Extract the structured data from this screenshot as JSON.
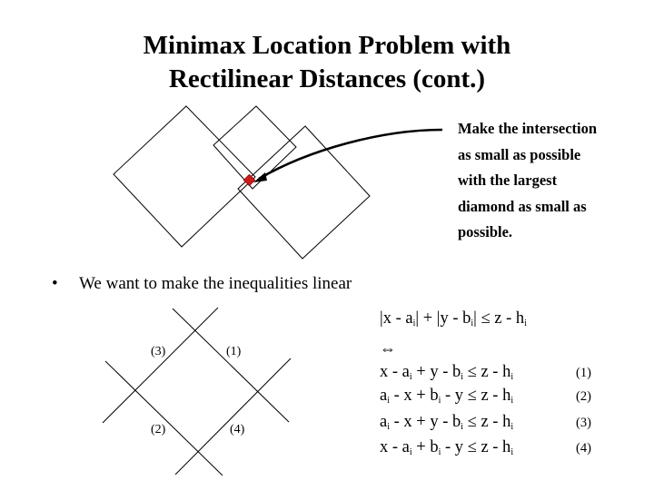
{
  "title": {
    "line1": "Minimax Location Problem with",
    "line2": "Rectilinear Distances (cont.)"
  },
  "callout": {
    "lines": [
      "Make the intersection",
      "as small as possible",
      "with the largest",
      "diamond as small as",
      "possible."
    ]
  },
  "colors": {
    "intersection_marker": "#cc1a1a",
    "lines": "#000000"
  },
  "bullet": {
    "symbol": "•",
    "text": "We want to make the inequalities linear"
  },
  "diagram_labels": {
    "top_left": "(3)",
    "top_right": "(1)",
    "bottom_left": "(2)",
    "bottom_right": "(4)"
  },
  "equations": {
    "absolute": {
      "p1": "|x - a",
      "s1": "i",
      "p2": "| + |y - b",
      "s2": "i",
      "p3": "| ≤ z - h",
      "s3": "i"
    },
    "equivalence_symbol": "⇔",
    "rows": [
      {
        "p1": "x - a",
        "s1": "i",
        "p2": " + y - b",
        "s2": "i",
        "p3": " ≤ z - h",
        "s3": "i",
        "num": "(1)"
      },
      {
        "p1": "a",
        "s1": "i",
        "p2": " - x + b",
        "s2": "i",
        "p3": " - y ≤ z - h",
        "s3": "i",
        "num": "(2)"
      },
      {
        "p1": "a",
        "s1": "i",
        "p2": " - x + y - b",
        "s2": "i",
        "p3": " ≤ z - h",
        "s3": "i",
        "num": "(3)"
      },
      {
        "p1": "x - a",
        "s1": "i",
        "p2": " + b",
        "s2": "i",
        "p3": " - y ≤ z - h",
        "s3": "i",
        "num": "(4)"
      }
    ]
  }
}
